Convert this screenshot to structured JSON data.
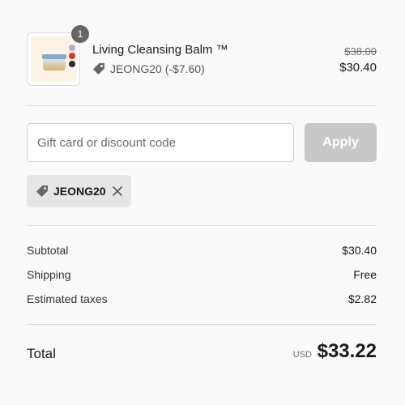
{
  "product": {
    "title": "Living Cleansing Balm ™",
    "quantity": "1",
    "discount_line": "JEONG20 (-$7.60)",
    "original_price": "$38.00",
    "price": "$30.40",
    "swatch_colors": [
      "#c9a2d8",
      "#d9342b",
      "#2b2b2b"
    ]
  },
  "discount": {
    "placeholder": "Gift card or discount code",
    "value": "",
    "apply_label": "Apply",
    "applied_code": "JEONG20"
  },
  "summary": {
    "subtotal_label": "Subtotal",
    "subtotal_value": "$30.40",
    "shipping_label": "Shipping",
    "shipping_value": "Free",
    "taxes_label": "Estimated taxes",
    "taxes_value": "$2.82"
  },
  "total": {
    "label": "Total",
    "currency": "USD",
    "value": "$33.22"
  },
  "icons": {
    "tag": "tag-icon",
    "close": "close-icon"
  },
  "colors": {
    "apply_disabled": "#c8c8c8",
    "chip_bg": "#e6e6e6",
    "badge": "#666666"
  }
}
